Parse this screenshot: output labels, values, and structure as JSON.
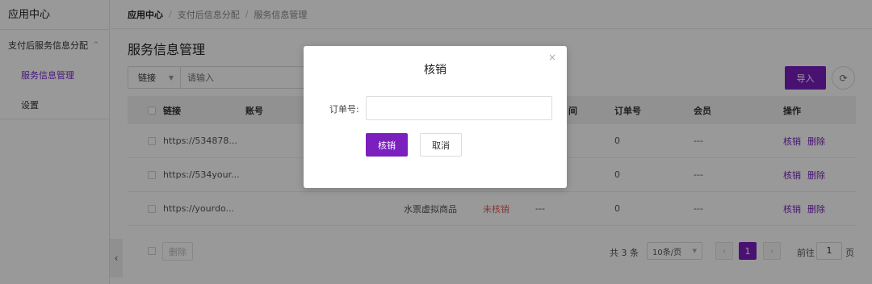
{
  "sidebar": {
    "title": "应用中心",
    "group_label": "支付后服务信息分配",
    "group_chevron": "^",
    "items": [
      {
        "label": "服务信息管理",
        "active": true
      },
      {
        "label": "设置",
        "active": false
      }
    ],
    "collapse_glyph": "‹"
  },
  "breadcrumb": {
    "items": [
      "应用中心",
      "支付后信息分配",
      "服务信息管理"
    ],
    "separator": "/"
  },
  "page_title": "服务信息管理",
  "filter": {
    "select_value": "链接",
    "input_placeholder": "请输入"
  },
  "toolbar": {
    "import_label": "导入",
    "refresh_icon": "refresh-icon"
  },
  "table": {
    "columns": [
      "链接",
      "账号",
      "",
      "",
      "间",
      "订单号",
      "会员",
      "操作"
    ],
    "rows": [
      {
        "link": "https://534878...",
        "account": "",
        "product": "",
        "status": "",
        "time": "",
        "order_no": "0",
        "member": "---",
        "actions": [
          "核销",
          "删除"
        ]
      },
      {
        "link": "https://534your...",
        "account": "",
        "product": "",
        "status": "",
        "time": "",
        "order_no": "0",
        "member": "---",
        "actions": [
          "核销",
          "删除"
        ]
      },
      {
        "link": "https://yourdo...",
        "account": "",
        "product": "水票虚拟商品",
        "status": "未核销",
        "time": "---",
        "order_no": "0",
        "member": "---",
        "actions": [
          "核销",
          "删除"
        ]
      }
    ]
  },
  "footer": {
    "delete_label": "删除",
    "total_text": "共 3 条",
    "page_size": "10条/页",
    "prev": "‹",
    "current_page": "1",
    "next": "›",
    "goto_prefix": "前往",
    "goto_value": "1",
    "goto_suffix": "页"
  },
  "modal": {
    "title": "核销",
    "close_glyph": "×",
    "field_label": "订单号:",
    "field_value": "",
    "confirm_label": "核销",
    "cancel_label": "取消"
  },
  "colors": {
    "accent": "#7b1fbf",
    "status_unverified": "#e35b5b"
  }
}
